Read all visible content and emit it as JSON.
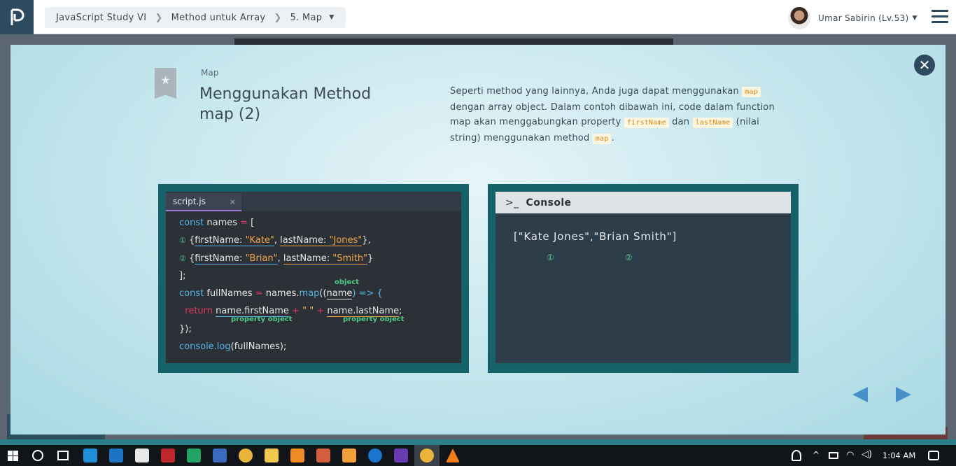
{
  "topbar": {
    "breadcrumb": [
      "JavaScript Study VI",
      "Method untuk Array",
      "5. Map"
    ],
    "user_name": "Umar Sabirin (Lv.53)"
  },
  "lesson": {
    "section": "Map",
    "title": "Menggunakan Method map (2)",
    "description": {
      "p1": "Seperti method yang lainnya, Anda juga dapat menggunakan",
      "code1": "map",
      "p2": "dengan array object. Dalam contoh dibawah ini, code dalam function map akan menggabungkan property",
      "code2": "firstName",
      "p3": "dan",
      "code3": "lastName",
      "p4": "(nilai string) menggunakan method",
      "code4": "map",
      "p5": "."
    }
  },
  "editor": {
    "tab_name": "script.js",
    "tab_close": "×",
    "kw_const": "const",
    "names": "names",
    "eq": " = ",
    "open_bracket": "[",
    "marker1": "①",
    "marker2": "②",
    "obj_open": "{",
    "obj_close": "}",
    "k_first": "firstName:",
    "k_last": "lastName:",
    "v_kate": "\"Kate\"",
    "v_jones": "\"Jones\"",
    "v_brian": "\"Brian\"",
    "v_smith": "\"Smith\"",
    "comma": ", ",
    "close_bracket": "];",
    "fullNames": "fullNames",
    "names_dot": "names.",
    "map": "map",
    "paren_open": "((",
    "name": "name",
    "arrow": ") => {",
    "kw_return": "return",
    "name_first": "name.firstName",
    "plus": " + ",
    "space_str": "\" \"",
    "name_last": "name.lastName",
    "semi": ";",
    "close_fn": "});",
    "console_log": "console.log",
    "log_arg": "(fullNames);",
    "ann_object": "object",
    "ann_prop1": "property object",
    "ann_prop2": "property object"
  },
  "console": {
    "title": "Console",
    "output": "[\"Kate Jones\",\"Brian Smith\"]",
    "marker1": "①",
    "marker2": "②"
  },
  "taskbar": {
    "time": "1:04 AM"
  },
  "colors": {
    "nav_dark": "#2e4a5f",
    "panel_teal": "#16626a",
    "code_bg": "#2b3137",
    "keyword_blue": "#56b4e6",
    "return_red": "#e0365f",
    "string_orange": "#f3a64a",
    "annotation_green": "#4fc98a",
    "arrow_blue": "#4a90c8"
  }
}
